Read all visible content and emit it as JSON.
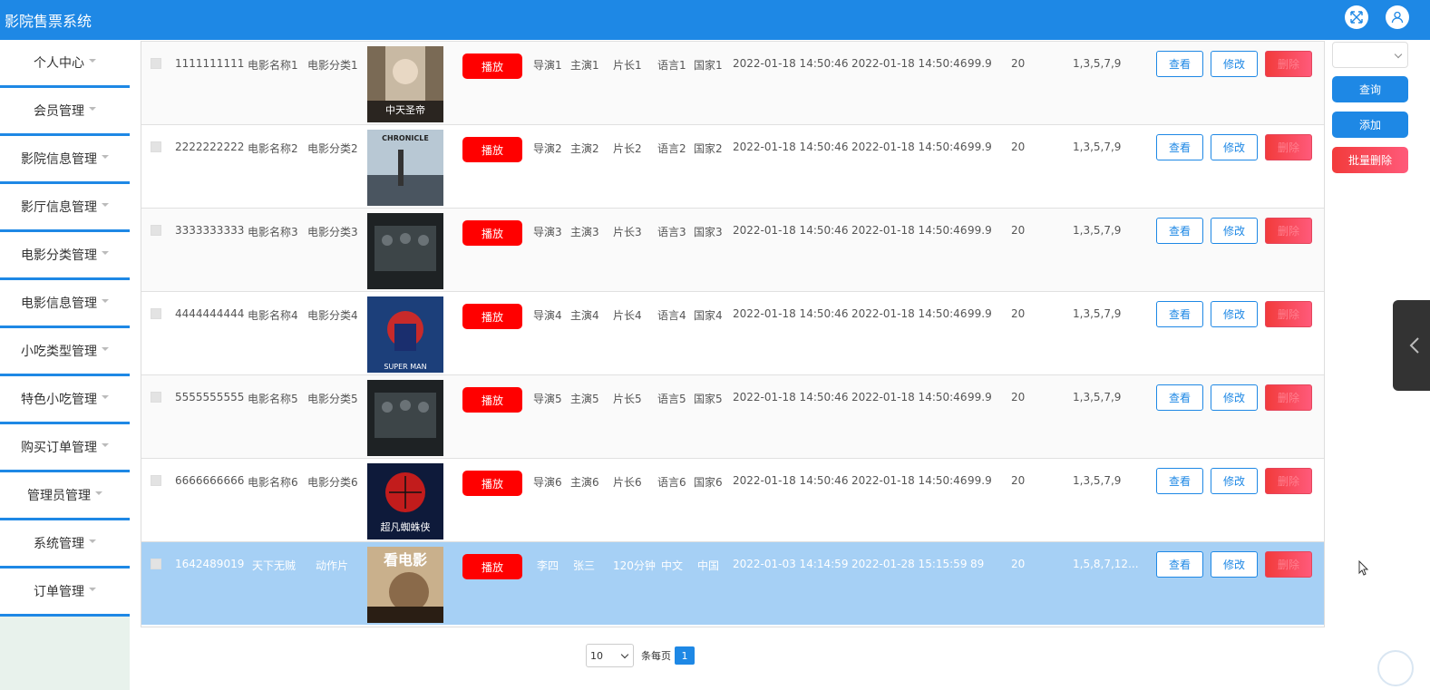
{
  "app": {
    "title": "影院售票系统"
  },
  "colors": {
    "primary": "#1e88e5",
    "danger": "#f23b3b",
    "play": "#ff0000",
    "selected_row": "#a6d0f5"
  },
  "header_icons": [
    "fullscreen-icon",
    "user-icon"
  ],
  "sidebar": {
    "items": [
      {
        "label": "个人中心"
      },
      {
        "label": "会员管理"
      },
      {
        "label": "影院信息管理"
      },
      {
        "label": "影厅信息管理"
      },
      {
        "label": "电影分类管理"
      },
      {
        "label": "电影信息管理"
      },
      {
        "label": "小吃类型管理"
      },
      {
        "label": "特色小吃管理"
      },
      {
        "label": "购买订单管理"
      },
      {
        "label": "管理员管理"
      },
      {
        "label": "系统管理"
      },
      {
        "label": "订单管理"
      }
    ]
  },
  "table": {
    "buttons": {
      "play": "播放",
      "view": "查看",
      "edit": "修改",
      "delete": "删除"
    },
    "rows": [
      {
        "id": "1111111111",
        "name": "电影名称1",
        "category": "电影分类1",
        "director": "导演1",
        "actor": "主演1",
        "duration": "片长1",
        "language": "语言1",
        "country": "国家1",
        "start": "2022-01-18 14:50:46",
        "end": "2022-01-18 14:50:46",
        "price": "99.9",
        "seats": "20",
        "schedule": "1,3,5,7,9",
        "selected": false
      },
      {
        "id": "2222222222",
        "name": "电影名称2",
        "category": "电影分类2",
        "director": "导演2",
        "actor": "主演2",
        "duration": "片长2",
        "language": "语言2",
        "country": "国家2",
        "start": "2022-01-18 14:50:46",
        "end": "2022-01-18 14:50:46",
        "price": "99.9",
        "seats": "20",
        "schedule": "1,3,5,7,9",
        "selected": false
      },
      {
        "id": "3333333333",
        "name": "电影名称3",
        "category": "电影分类3",
        "director": "导演3",
        "actor": "主演3",
        "duration": "片长3",
        "language": "语言3",
        "country": "国家3",
        "start": "2022-01-18 14:50:46",
        "end": "2022-01-18 14:50:46",
        "price": "99.9",
        "seats": "20",
        "schedule": "1,3,5,7,9",
        "selected": false
      },
      {
        "id": "4444444444",
        "name": "电影名称4",
        "category": "电影分类4",
        "director": "导演4",
        "actor": "主演4",
        "duration": "片长4",
        "language": "语言4",
        "country": "国家4",
        "start": "2022-01-18 14:50:46",
        "end": "2022-01-18 14:50:46",
        "price": "99.9",
        "seats": "20",
        "schedule": "1,3,5,7,9",
        "selected": false
      },
      {
        "id": "5555555555",
        "name": "电影名称5",
        "category": "电影分类5",
        "director": "导演5",
        "actor": "主演5",
        "duration": "片长5",
        "language": "语言5",
        "country": "国家5",
        "start": "2022-01-18 14:50:46",
        "end": "2022-01-18 14:50:46",
        "price": "99.9",
        "seats": "20",
        "schedule": "1,3,5,7,9",
        "selected": false
      },
      {
        "id": "6666666666",
        "name": "电影名称6",
        "category": "电影分类6",
        "director": "导演6",
        "actor": "主演6",
        "duration": "片长6",
        "language": "语言6",
        "country": "国家6",
        "start": "2022-01-18 14:50:46",
        "end": "2022-01-18 14:50:46",
        "price": "99.9",
        "seats": "20",
        "schedule": "1,3,5,7,9",
        "selected": false
      },
      {
        "id": "1642489019",
        "name": "天下无贼",
        "category": "动作片",
        "director": "李四",
        "actor": "张三",
        "duration": "120分钟",
        "language": "中文",
        "country": "中国",
        "start": "2022-01-03 14:14:59",
        "end": "2022-01-28 15:15:59",
        "price": "89",
        "seats": "20",
        "schedule": "1,5,8,7,12...",
        "selected": true
      }
    ],
    "posters": [
      {
        "title": "中天圣帝"
      },
      {
        "title": "CHRONICLE"
      },
      {
        "title": ""
      },
      {
        "title": "SUPER MAN"
      },
      {
        "title": ""
      },
      {
        "title": "超凡蜘蛛侠"
      },
      {
        "title": "看电影"
      }
    ]
  },
  "right_panel": {
    "select_value": "",
    "query_label": "查询",
    "add_label": "添加",
    "batch_delete_label": "批量删除"
  },
  "pagination": {
    "page_size": "10",
    "per_page_label": "条每页",
    "current_page": "1"
  }
}
